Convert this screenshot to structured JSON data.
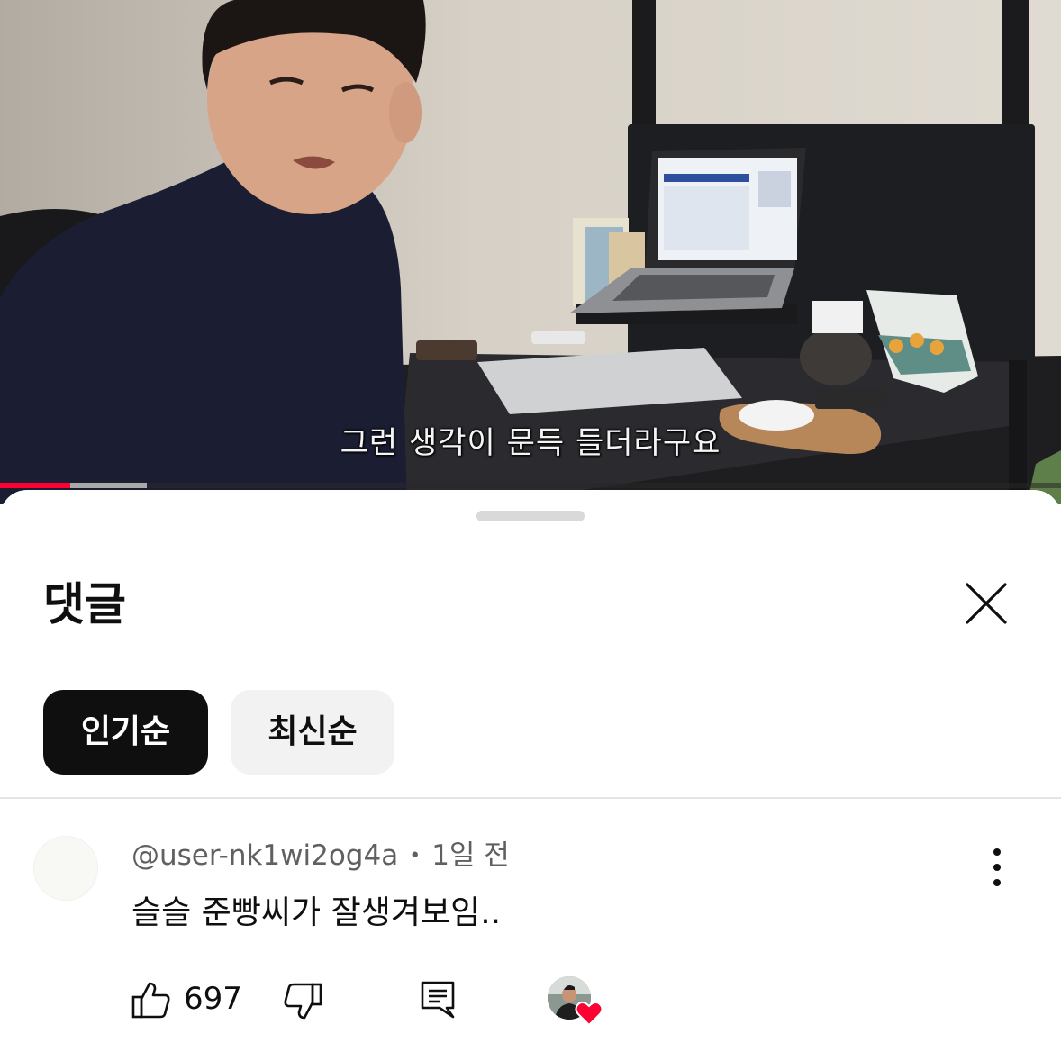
{
  "video": {
    "subtitle": "그런 생각이 문득 들더라구요",
    "progress": {
      "played": 0.066,
      "buffered": 0.138
    }
  },
  "sheet": {
    "title": "댓글",
    "close_icon": "close-icon"
  },
  "sort_chips": [
    {
      "label": "인기순",
      "selected": true
    },
    {
      "label": "최신순",
      "selected": false
    }
  ],
  "comments": [
    {
      "author": "@user-nk1wi2og4a",
      "separator": "•",
      "time": "1일 전",
      "text": "슬슬 준빵씨가 잘생겨보임..",
      "likes": "697",
      "creator_hearted": true,
      "icons": {
        "like": "thumbs-up-icon",
        "dislike": "thumbs-down-icon",
        "reply": "reply-icon",
        "menu": "more-vert-icon",
        "heart": "heart-icon"
      }
    }
  ],
  "colors": {
    "progress_played": "#ff0033",
    "chip_selected_bg": "#0f0f0f",
    "chip_unselected_bg": "#f2f2f2",
    "meta_text": "#606060",
    "heart": "#ff0033"
  }
}
